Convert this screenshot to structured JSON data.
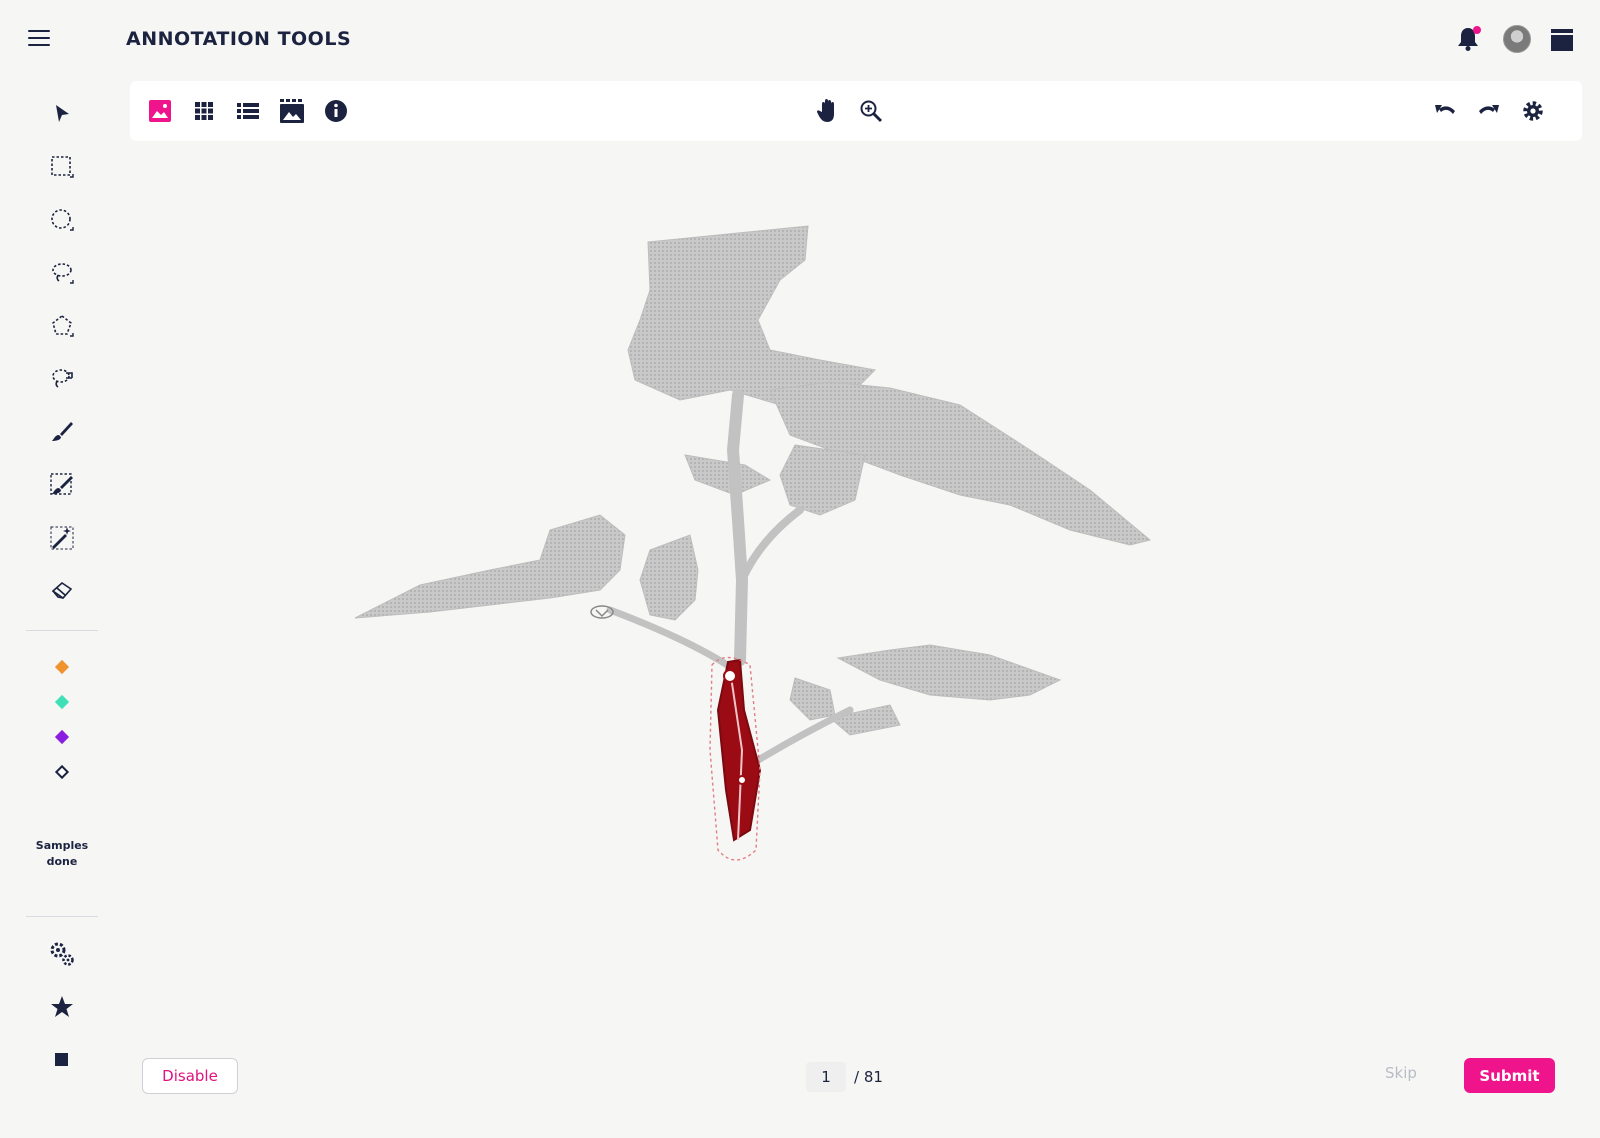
{
  "header": {
    "title": "ANNOTATION TOOLS",
    "notification_dot_color": "#f0148c"
  },
  "sidebar": {
    "tools": [
      "pointer-icon",
      "rectangle-select-icon",
      "ellipse-select-icon",
      "lasso-icon",
      "polygon-select-icon",
      "magnetic-lasso-icon",
      "brush-icon",
      "brush-select-icon",
      "magic-wand-icon",
      "eraser-icon"
    ],
    "active_tool": "brush-select-icon",
    "label_colors": [
      "#f0922d",
      "#3fe0b8",
      "#8a1ee0",
      "#1c2340"
    ],
    "samples_label": "Samples done",
    "bottom_icons": [
      "gears-icon",
      "star-icon",
      "stop-icon"
    ]
  },
  "toolbar": {
    "left": [
      "image-view-icon",
      "grid-view-icon",
      "list-view-icon",
      "gallery-icon",
      "info-icon"
    ],
    "active_view": "image-view-icon",
    "center": [
      "pan-hand-icon",
      "zoom-in-icon"
    ],
    "right": [
      "undo-icon",
      "redo-icon",
      "settings-icon"
    ]
  },
  "footer": {
    "disable_label": "Disable",
    "page_current": "1",
    "page_total": "/ 81",
    "skip_label": "Skip",
    "submit_label": "Submit"
  },
  "colors": {
    "accent": "#f0148c",
    "annotation": "#9a0b14",
    "navy": "#1c2340"
  }
}
